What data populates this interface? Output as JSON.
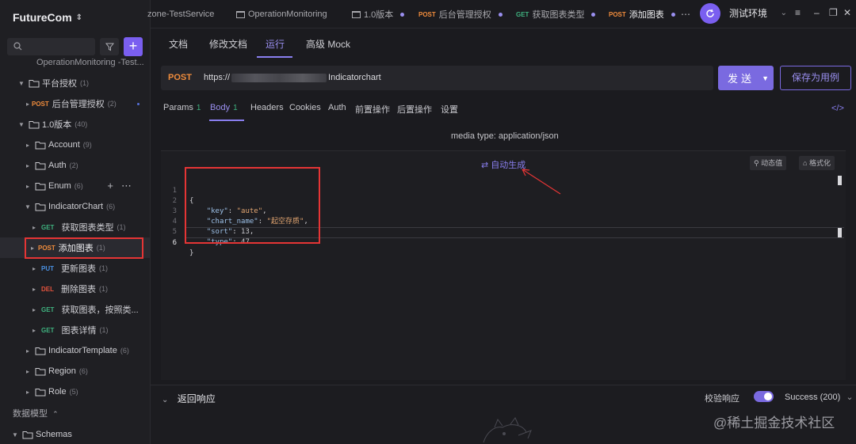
{
  "workspace": {
    "name": "FutureCom"
  },
  "sidebar": {
    "search_placeholder": "",
    "tree": [
      {
        "label": "OperationMonitoring -Test...",
        "count": ""
      },
      {
        "label": "平台授权",
        "count": "(1)"
      },
      {
        "method": "POST",
        "label": "后台管理授权",
        "count": "(2)"
      },
      {
        "label": "1.0版本",
        "count": "(40)"
      },
      {
        "label": "Account",
        "count": "(9)"
      },
      {
        "label": "Auth",
        "count": "(2)"
      },
      {
        "label": "Enum",
        "count": "(6)"
      },
      {
        "label": "IndicatorChart",
        "count": "(6)"
      },
      {
        "method": "GET",
        "label": "获取图表类型",
        "count": "(1)"
      },
      {
        "method": "POST",
        "label": "添加图表",
        "count": "(1)"
      },
      {
        "method": "PUT",
        "label": "更新图表",
        "count": "(1)"
      },
      {
        "method": "DEL",
        "label": "删除图表",
        "count": "(1)"
      },
      {
        "method": "GET",
        "label": "获取图表，按照类...",
        "count": ""
      },
      {
        "method": "GET",
        "label": "图表详情",
        "count": "(1)"
      },
      {
        "label": "IndicatorTemplate",
        "count": "(6)"
      },
      {
        "label": "Region",
        "count": "(6)"
      },
      {
        "label": "Role",
        "count": "(5)"
      }
    ],
    "section_title": "数据模型",
    "schemas_label": "Schemas"
  },
  "tabs": [
    {
      "label": "zone-TestService"
    },
    {
      "label": "OperationMonitoring"
    },
    {
      "label": "1.0版本"
    },
    {
      "method": "POST",
      "label": "后台管理授权"
    },
    {
      "method": "GET",
      "label": "获取图表类型"
    },
    {
      "method": "POST",
      "label": "添加图表"
    }
  ],
  "environment": {
    "label": "测试环境"
  },
  "subtabs": [
    "文档",
    "修改文档",
    "运行",
    "高级 Mock"
  ],
  "request": {
    "method": "POST",
    "url_prefix": "https://",
    "url_suffix": "Indicatorchart",
    "send_label": "发送",
    "save_label": "保存为用例"
  },
  "param_tabs": [
    {
      "label": "Params",
      "count": "1"
    },
    {
      "label": "Body",
      "count": "1"
    },
    {
      "label": "Headers",
      "count": ""
    },
    {
      "label": "Cookies",
      "count": ""
    },
    {
      "label": "Auth",
      "count": ""
    },
    {
      "label": "前置操作",
      "count": ""
    },
    {
      "label": "后置操作",
      "count": ""
    },
    {
      "label": "设置",
      "count": ""
    }
  ],
  "body": {
    "media_type": "media type: application/json",
    "auto_generate": "自动生成",
    "dynamic_value": "动态值",
    "format": "格式化",
    "lines": [
      {
        "no": "1"
      },
      {
        "no": "2",
        "key": "\"key\"",
        "value": "\"aute\""
      },
      {
        "no": "3",
        "key": "\"chart_name\"",
        "value": "\"起空存质\""
      },
      {
        "no": "4",
        "key": "\"sort\"",
        "value": "13"
      },
      {
        "no": "5",
        "key": "\"type\"",
        "value": "47"
      },
      {
        "no": "6"
      }
    ]
  },
  "response": {
    "title": "返回响应",
    "verify_label": "校验响应",
    "status": "Success (200)"
  },
  "watermark": "@稀土掘金技术社区",
  "colors": {
    "accent": "#7a6ae0",
    "post": "#f08c3c",
    "get": "#3fb27f",
    "put": "#4a90e2",
    "del": "#e5533d",
    "highlight": "#e53535"
  }
}
